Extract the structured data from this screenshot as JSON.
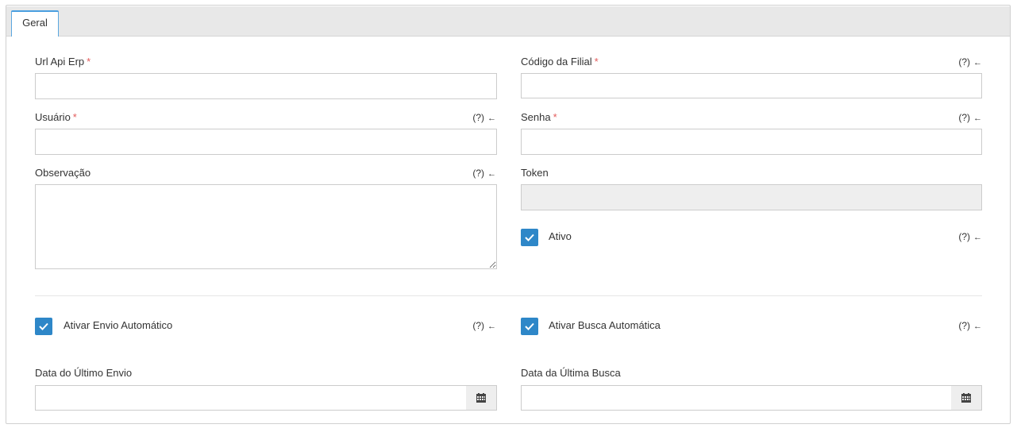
{
  "tabs": [
    {
      "label": "Geral",
      "active": true
    }
  ],
  "help_text": "(?)",
  "help_arrow": "←",
  "required_mark": "*",
  "fields": {
    "url_api_erp": {
      "label": "Url Api Erp",
      "value": ""
    },
    "codigo_filial": {
      "label": "Código da Filial",
      "value": ""
    },
    "usuario": {
      "label": "Usuário",
      "value": ""
    },
    "senha": {
      "label": "Senha",
      "value": ""
    },
    "observacao": {
      "label": "Observação",
      "value": ""
    },
    "token": {
      "label": "Token",
      "value": ""
    },
    "ativo": {
      "label": "Ativo",
      "checked": true
    },
    "ativar_envio": {
      "label": "Ativar Envio Automático",
      "checked": true
    },
    "ativar_busca": {
      "label": "Ativar Busca Automática",
      "checked": true
    },
    "data_ultimo_envio": {
      "label": "Data do Último Envio",
      "value": ""
    },
    "data_ultima_busca": {
      "label": "Data da Última Busca",
      "value": ""
    }
  },
  "icons": {
    "check": "check-icon",
    "calendar": "calendar-icon"
  },
  "colors": {
    "accent": "#2e87c8",
    "required": "#e35b5b",
    "tab_border": "#5aa7e0"
  }
}
